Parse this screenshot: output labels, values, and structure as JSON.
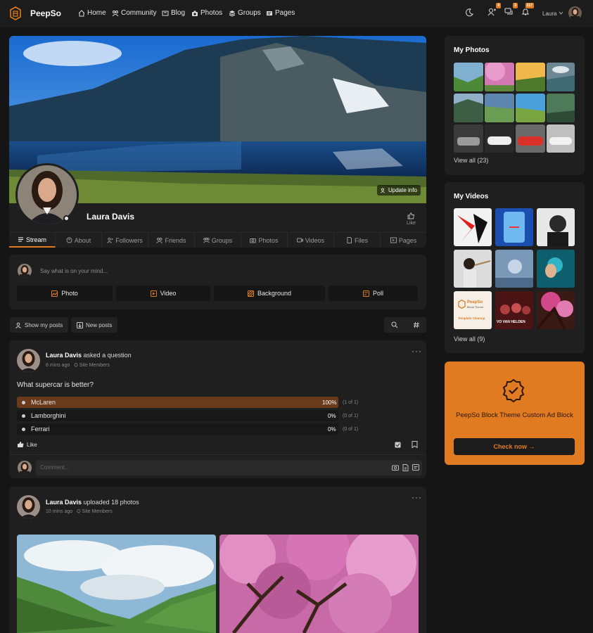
{
  "brand": {
    "name": "PeepSo",
    "accent": "#e07b22"
  },
  "nav": {
    "items": [
      {
        "label": "Home",
        "icon": "home-icon"
      },
      {
        "label": "Community",
        "icon": "community-icon"
      },
      {
        "label": "Blog",
        "icon": "blog-icon"
      },
      {
        "label": "Photos",
        "icon": "camera-icon"
      },
      {
        "label": "Groups",
        "icon": "groups-icon"
      },
      {
        "label": "Pages",
        "icon": "pages-icon"
      }
    ],
    "badges": {
      "friends": "4",
      "messages": "3",
      "notifications": "217"
    },
    "user": "Laura"
  },
  "profile": {
    "name": "Laura Davis",
    "update_info": "Update info",
    "like": "Like",
    "tabs": [
      {
        "label": "Stream",
        "icon": "stream-icon"
      },
      {
        "label": "About",
        "icon": "about-icon"
      },
      {
        "label": "Followers",
        "icon": "followers-icon"
      },
      {
        "label": "Friends",
        "icon": "friends-icon"
      },
      {
        "label": "Groups",
        "icon": "groups-icon"
      },
      {
        "label": "Photos",
        "icon": "camera-icon"
      },
      {
        "label": "Videos",
        "icon": "video-icon"
      },
      {
        "label": "Files",
        "icon": "files-icon"
      },
      {
        "label": "Pages",
        "icon": "pages-icon"
      }
    ]
  },
  "composer": {
    "placeholder": "Say what is on your mind...",
    "buttons": [
      "Photo",
      "Video",
      "Background",
      "Poll"
    ]
  },
  "filters": {
    "show_posts": "Show my posts",
    "new_posts": "New posts"
  },
  "post1": {
    "author": "Laura Davis",
    "action": "asked a question",
    "time": "8 mins ago",
    "audience": "Site Members",
    "question": "What supercar is better?",
    "poll": [
      {
        "label": "McLaren",
        "pct": "100%",
        "count": "(1 of 1)",
        "fill": 1.0
      },
      {
        "label": "Lamborghini",
        "pct": "0%",
        "count": "(0 of 1)",
        "fill": 0
      },
      {
        "label": "Ferrari",
        "pct": "0%",
        "count": "(0 of 1)",
        "fill": 0
      }
    ],
    "like": "Like",
    "comment_placeholder": "Comment..."
  },
  "post2": {
    "author": "Laura Davis",
    "action": "uploaded 18 photos",
    "time": "10 mins ago",
    "audience": "Site Members"
  },
  "sidebar": {
    "photos_title": "My Photos",
    "photos_view_all": "View all (23)",
    "videos_title": "My Videos",
    "videos_view_all": "View all (9)",
    "template_thumb": {
      "brand": "PeepSo",
      "sub": "Block Theme",
      "caption": "Template Cleanup"
    },
    "video_caption": "VO VAN HELDEN"
  },
  "ad": {
    "title": "PeepSo Block Theme Custom Ad Block",
    "button": "Check now →"
  }
}
